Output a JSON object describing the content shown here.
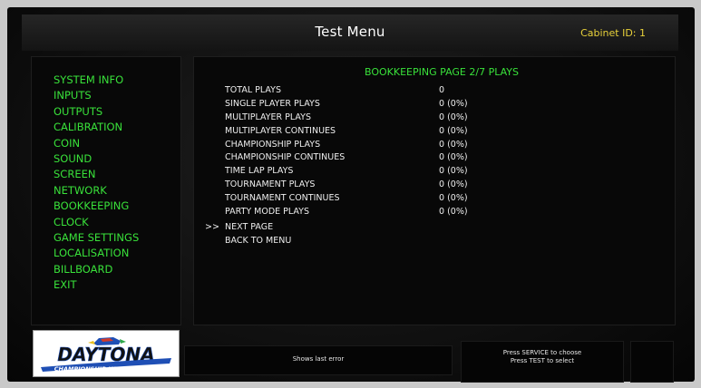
{
  "header": {
    "title": "Test Menu",
    "cabinet_label": "Cabinet ID: 1"
  },
  "sidebar": {
    "items": [
      {
        "label": "SYSTEM INFO"
      },
      {
        "label": "INPUTS"
      },
      {
        "label": "OUTPUTS"
      },
      {
        "label": "CALIBRATION"
      },
      {
        "label": "COIN"
      },
      {
        "label": "SOUND"
      },
      {
        "label": "SCREEN"
      },
      {
        "label": "NETWORK"
      },
      {
        "label": "BOOKKEEPING"
      },
      {
        "label": "CLOCK"
      },
      {
        "label": "GAME SETTINGS"
      },
      {
        "label": "LOCALISATION"
      },
      {
        "label": "BILLBOARD"
      },
      {
        "label": "EXIT"
      }
    ]
  },
  "main": {
    "heading": "BOOKKEEPING PAGE 2/7 PLAYS",
    "rows": [
      {
        "label": "TOTAL PLAYS",
        "value": "0"
      },
      {
        "label": "SINGLE PLAYER PLAYS",
        "value": "0 (0%)"
      },
      {
        "label": "MULTIPLAYER PLAYS",
        "value": "0 (0%)"
      },
      {
        "label": "MULTIPLAYER CONTINUES",
        "value": "0 (0%)"
      },
      {
        "label": "CHAMPIONSHIP PLAYS",
        "value": "0 (0%)"
      },
      {
        "label": "CHAMPIONSHIP CONTINUES",
        "value": "0 (0%)"
      },
      {
        "label": "TIME LAP PLAYS",
        "value": "0 (0%)"
      },
      {
        "label": "TOURNAMENT PLAYS",
        "value": "0 (0%)"
      },
      {
        "label": "TOURNAMENT CONTINUES",
        "value": "0 (0%)"
      },
      {
        "label": "PARTY MODE PLAYS",
        "value": "0 (0%)"
      }
    ],
    "actions": [
      {
        "cursor": ">>",
        "label": "NEXT PAGE"
      },
      {
        "cursor": "",
        "label": "BACK TO MENU"
      }
    ]
  },
  "logo": {
    "wordmark": "DAYTONA",
    "subtitle": "CHAMPIONSHIP USA"
  },
  "footer": {
    "status_left": "Shows last error",
    "status_right_line1": "Press SERVICE to choose",
    "status_right_line2": "Press TEST to select"
  },
  "colors": {
    "menu_green": "#39e13a",
    "cabinet_yellow": "#e8d13a",
    "text_white": "#eeeeee"
  }
}
